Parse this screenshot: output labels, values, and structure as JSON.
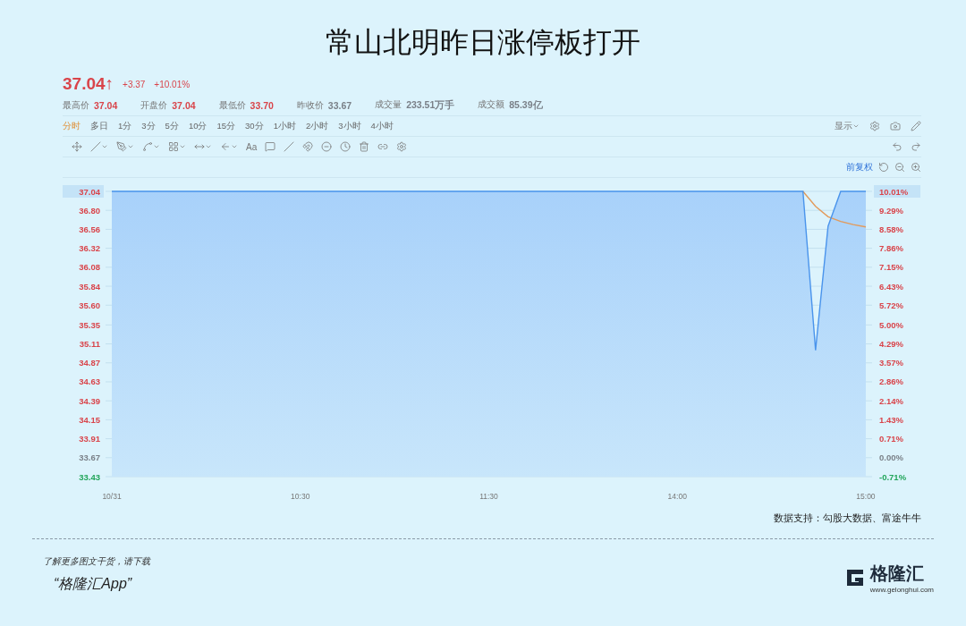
{
  "title": "常山北明昨日涨停板打开",
  "quote": {
    "price": "37.04",
    "arrow": "↑",
    "color": "#d9444a",
    "change": "+3.37",
    "change_pct": "+10.01%"
  },
  "stats": [
    {
      "label": "最高价",
      "value": "37.04",
      "color": "#d9444a"
    },
    {
      "label": "开盘价",
      "value": "37.04",
      "color": "#d9444a"
    },
    {
      "label": "最低价",
      "value": "33.70",
      "color": "#d9444a"
    },
    {
      "label": "昨收价",
      "value": "33.67",
      "color": "#7a8088"
    },
    {
      "label": "成交量",
      "value": "233.51万手",
      "color": "#7a8088"
    },
    {
      "label": "成交额",
      "value": "85.39亿",
      "color": "#7a8088"
    }
  ],
  "periods": [
    {
      "label": "分时",
      "selected": true
    },
    {
      "label": "多日",
      "selected": false
    },
    {
      "label": "1分",
      "selected": false
    },
    {
      "label": "3分",
      "selected": false
    },
    {
      "label": "5分",
      "selected": false
    },
    {
      "label": "10分",
      "selected": false
    },
    {
      "label": "15分",
      "selected": false
    },
    {
      "label": "30分",
      "selected": false
    },
    {
      "label": "1小时",
      "selected": false
    },
    {
      "label": "2小时",
      "selected": false
    },
    {
      "label": "3小时",
      "selected": false
    },
    {
      "label": "4小时",
      "selected": false
    }
  ],
  "display_menu": "显示",
  "text_tool": "Aa",
  "adjust_mode": "前复权",
  "chart_data": {
    "type": "line",
    "categories": [
      "10/31",
      null,
      null,
      null,
      null,
      null,
      null,
      null,
      null,
      null,
      null,
      null,
      null,
      null,
      null,
      "10:30",
      null,
      null,
      null,
      null,
      null,
      null,
      null,
      null,
      null,
      null,
      null,
      null,
      null,
      null,
      "11:30",
      null,
      null,
      null,
      null,
      null,
      null,
      null,
      null,
      null,
      null,
      null,
      null,
      null,
      null,
      "14:00",
      null,
      null,
      null,
      null,
      null,
      null,
      null,
      null,
      null,
      null,
      null,
      null,
      null,
      null,
      "15:00"
    ],
    "series": [
      {
        "color": "#4a94ec",
        "values": [
          37.04,
          37.04,
          37.04,
          37.04,
          37.04,
          37.04,
          37.04,
          37.04,
          37.04,
          37.04,
          37.04,
          37.04,
          37.04,
          37.04,
          37.04,
          37.04,
          37.04,
          37.04,
          37.04,
          37.04,
          37.04,
          37.04,
          37.04,
          37.04,
          37.04,
          37.04,
          37.04,
          37.04,
          37.04,
          37.04,
          37.04,
          37.04,
          37.04,
          37.04,
          37.04,
          37.04,
          37.04,
          37.04,
          37.04,
          37.04,
          37.04,
          37.04,
          37.04,
          37.04,
          37.04,
          37.04,
          37.04,
          37.04,
          37.04,
          37.04,
          37.04,
          37.04,
          37.04,
          37.04,
          37.04,
          37.04,
          35.03,
          36.6,
          37.04,
          37.04,
          37.04
        ]
      },
      {
        "color": "#e39a5a",
        "values": [
          null,
          null,
          null,
          null,
          null,
          null,
          null,
          null,
          null,
          null,
          null,
          null,
          null,
          null,
          null,
          null,
          null,
          null,
          null,
          null,
          null,
          null,
          null,
          null,
          null,
          null,
          null,
          null,
          null,
          null,
          null,
          null,
          null,
          null,
          null,
          null,
          null,
          null,
          null,
          null,
          null,
          null,
          null,
          null,
          null,
          null,
          null,
          null,
          null,
          null,
          null,
          null,
          null,
          null,
          null,
          37.04,
          36.85,
          36.72,
          36.66,
          36.62,
          36.59
        ]
      }
    ],
    "grid": true,
    "ylim": [
      33.43,
      37.04
    ],
    "yticks": [
      {
        "value": 37.04,
        "label": "37.04"
      },
      {
        "value": 36.8,
        "label": "36.80"
      },
      {
        "value": 36.56,
        "label": "36.56"
      },
      {
        "value": 36.32,
        "label": "36.32"
      },
      {
        "value": 36.08,
        "label": "36.08"
      },
      {
        "value": 35.84,
        "label": "35.84"
      },
      {
        "value": 35.6,
        "label": "35.60"
      },
      {
        "value": 35.35,
        "label": "35.35"
      },
      {
        "value": 35.11,
        "label": "35.11"
      },
      {
        "value": 34.87,
        "label": "34.87"
      },
      {
        "value": 34.63,
        "label": "34.63"
      },
      {
        "value": 34.39,
        "label": "34.39"
      },
      {
        "value": 34.15,
        "label": "34.15"
      },
      {
        "value": 33.91,
        "label": "33.91"
      },
      {
        "value": 33.67,
        "label": "33.67"
      },
      {
        "value": 33.43,
        "label": "33.43"
      }
    ]
  },
  "percent_axis": [
    {
      "label": "10.01%",
      "color": "#d9444a"
    },
    {
      "label": "9.29%",
      "color": "#d9444a"
    },
    {
      "label": "8.58%",
      "color": "#d9444a"
    },
    {
      "label": "7.86%",
      "color": "#d9444a"
    },
    {
      "label": "7.15%",
      "color": "#d9444a"
    },
    {
      "label": "6.43%",
      "color": "#d9444a"
    },
    {
      "label": "5.72%",
      "color": "#d9444a"
    },
    {
      "label": "5.00%",
      "color": "#d9444a"
    },
    {
      "label": "4.29%",
      "color": "#d9444a"
    },
    {
      "label": "3.57%",
      "color": "#d9444a"
    },
    {
      "label": "2.86%",
      "color": "#d9444a"
    },
    {
      "label": "2.14%",
      "color": "#d9444a"
    },
    {
      "label": "1.43%",
      "color": "#d9444a"
    },
    {
      "label": "0.71%",
      "color": "#d9444a"
    },
    {
      "label": "0.00%",
      "color": "#7a8088"
    },
    {
      "label": "-0.71%",
      "color": "#22a55a"
    }
  ],
  "source": "数据支持：勾股大数据、富途牛牛",
  "footer": {
    "prompt": "了解更多图文干货，请下载",
    "app": "“格隆汇App”",
    "brand": "格隆汇",
    "brand_url": "www.gelonghui.com"
  }
}
